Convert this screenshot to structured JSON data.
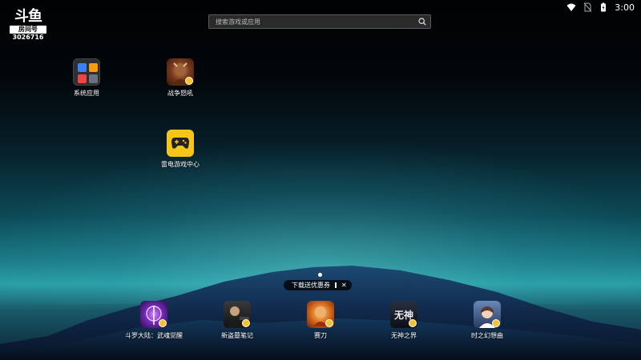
{
  "status_bar": {
    "time": "3:00",
    "icons": [
      "wifi-icon",
      "no-sim-icon",
      "battery-icon"
    ]
  },
  "logo": {
    "brand": "斗鱼",
    "room_label": "房间号",
    "room_id": "3026716"
  },
  "search": {
    "placeholder": "搜索游戏或应用",
    "icon": "search-icon"
  },
  "desktop_apps": [
    {
      "label": "系统应用",
      "icon": "system-apps-folder-icon"
    },
    {
      "label": "战争怒吼",
      "icon": "war-game-icon"
    },
    {
      "label": "雷电游戏中心",
      "icon": "gamepad-icon"
    }
  ],
  "page_indicator": {
    "current": 1,
    "total": 1
  },
  "coupon_banner": {
    "text": "下载送优惠券"
  },
  "dock_apps": [
    {
      "label": "斗罗大陆：武魂觉醒",
      "icon": "douluo-game-icon"
    },
    {
      "label": "新盗墓笔记",
      "icon": "tomb-notes-game-icon"
    },
    {
      "label": "赛刀",
      "icon": "saidao-game-icon"
    },
    {
      "label": "无神之界",
      "icon": "wushen-game-icon",
      "icon_text": "无神"
    },
    {
      "label": "时之幻想曲",
      "icon": "time-fantasy-game-icon"
    }
  ],
  "colors": {
    "badge": "#f7c22c",
    "game_center_bg": "#f5c518"
  }
}
